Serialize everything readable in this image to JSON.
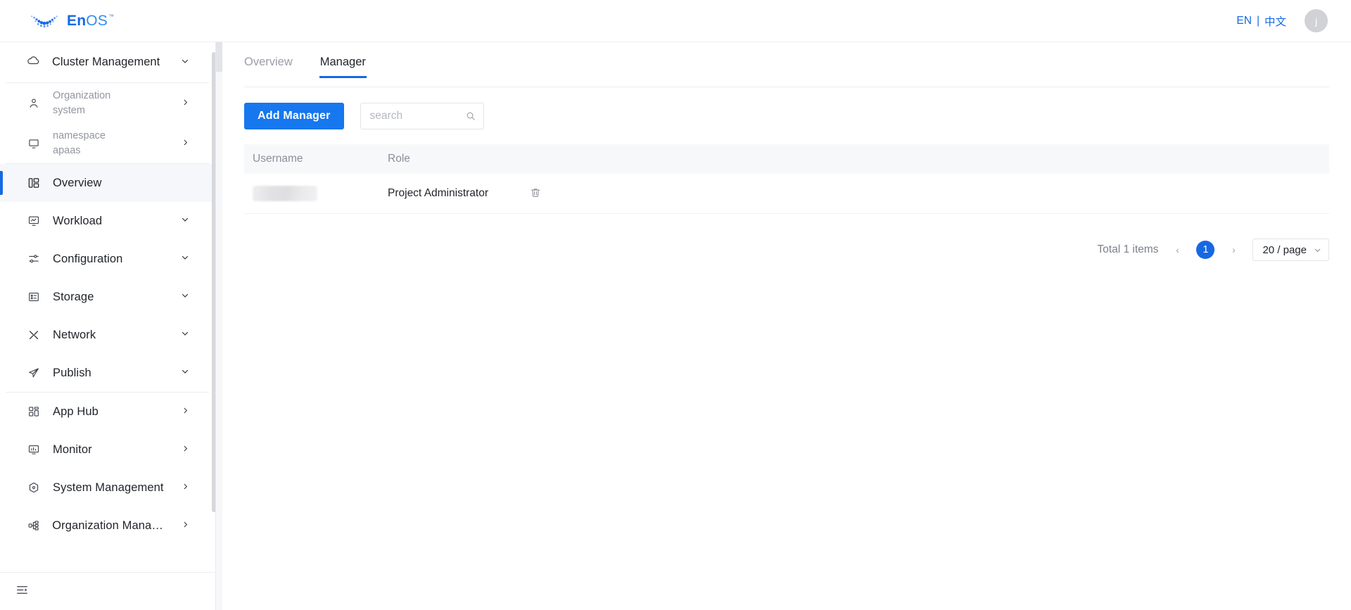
{
  "header": {
    "logo_en": "En",
    "logo_os": "OS",
    "logo_tm": "™",
    "lang_en": "EN",
    "lang_sep": "|",
    "lang_zh": "中文",
    "avatar_initial": "j"
  },
  "sidebar": {
    "cluster": {
      "label": "Cluster Management",
      "icon": "cloud-icon",
      "caret": "chevron-down-icon"
    },
    "context_items": [
      {
        "line1": "Organization",
        "line2": "system",
        "icon": "user-icon",
        "arrow": "chevron-right-icon"
      },
      {
        "line1": "namespace",
        "line2": "apaas",
        "icon": "monitor-icon",
        "arrow": "chevron-right-icon"
      }
    ],
    "items": [
      {
        "label": "Overview",
        "icon": "dashboard-icon",
        "active": true,
        "arrow": ""
      },
      {
        "label": "Workload",
        "icon": "workload-icon",
        "active": false,
        "arrow": "chevron-down-icon"
      },
      {
        "label": "Configuration",
        "icon": "sliders-icon",
        "active": false,
        "arrow": "chevron-down-icon"
      },
      {
        "label": "Storage",
        "icon": "storage-icon",
        "active": false,
        "arrow": "chevron-down-icon"
      },
      {
        "label": "Network",
        "icon": "network-icon",
        "active": false,
        "arrow": "chevron-down-icon"
      },
      {
        "label": "Publish",
        "icon": "send-icon",
        "active": false,
        "arrow": "chevron-down-icon"
      },
      {
        "label": "App Hub",
        "icon": "grid-icon",
        "active": false,
        "arrow": "chevron-right-icon"
      },
      {
        "label": "Monitor",
        "icon": "monitor-chart-icon",
        "active": false,
        "arrow": "chevron-right-icon"
      },
      {
        "label": "System Management",
        "icon": "gear-hex-icon",
        "active": false,
        "arrow": "chevron-right-icon"
      },
      {
        "label": "Organization Manage...",
        "icon": "org-tree-icon",
        "active": false,
        "arrow": "chevron-right-icon"
      }
    ],
    "collapse_icon": "menu-fold-icon"
  },
  "main": {
    "tabs": [
      {
        "label": "Overview",
        "active": false
      },
      {
        "label": "Manager",
        "active": true
      }
    ],
    "toolbar": {
      "add_button": "Add Manager",
      "search_placeholder": "search",
      "search_value": "",
      "search_icon": "search-icon"
    },
    "table": {
      "columns": [
        "Username",
        "Role"
      ],
      "rows": [
        {
          "username": "",
          "username_redacted": true,
          "role": "Project Administrator",
          "delete_icon": "trash-icon"
        }
      ]
    },
    "pagination": {
      "total_text": "Total 1 items",
      "prev": "‹",
      "next": "›",
      "current_page": "1",
      "page_size": "20 / page",
      "page_size_caret": "chevron-down-icon"
    }
  },
  "colors": {
    "primary": "#1668e3",
    "button": "#1677ef",
    "active_bg": "#f5f7fa",
    "header_bg": "#f7f8fa",
    "text": "#1f2329",
    "muted": "#9296a0"
  }
}
